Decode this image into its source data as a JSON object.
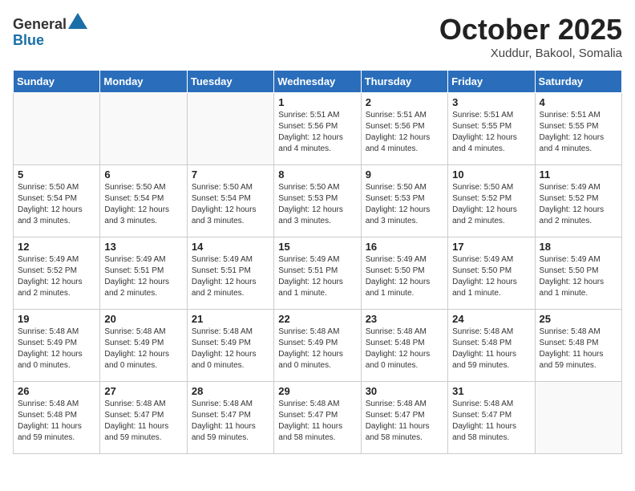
{
  "header": {
    "logo_general": "General",
    "logo_blue": "Blue",
    "month_title": "October 2025",
    "location": "Xuddur, Bakool, Somalia"
  },
  "days_of_week": [
    "Sunday",
    "Monday",
    "Tuesday",
    "Wednesday",
    "Thursday",
    "Friday",
    "Saturday"
  ],
  "weeks": [
    [
      {
        "num": "",
        "info": ""
      },
      {
        "num": "",
        "info": ""
      },
      {
        "num": "",
        "info": ""
      },
      {
        "num": "1",
        "info": "Sunrise: 5:51 AM\nSunset: 5:56 PM\nDaylight: 12 hours\nand 4 minutes."
      },
      {
        "num": "2",
        "info": "Sunrise: 5:51 AM\nSunset: 5:56 PM\nDaylight: 12 hours\nand 4 minutes."
      },
      {
        "num": "3",
        "info": "Sunrise: 5:51 AM\nSunset: 5:55 PM\nDaylight: 12 hours\nand 4 minutes."
      },
      {
        "num": "4",
        "info": "Sunrise: 5:51 AM\nSunset: 5:55 PM\nDaylight: 12 hours\nand 4 minutes."
      }
    ],
    [
      {
        "num": "5",
        "info": "Sunrise: 5:50 AM\nSunset: 5:54 PM\nDaylight: 12 hours\nand 3 minutes."
      },
      {
        "num": "6",
        "info": "Sunrise: 5:50 AM\nSunset: 5:54 PM\nDaylight: 12 hours\nand 3 minutes."
      },
      {
        "num": "7",
        "info": "Sunrise: 5:50 AM\nSunset: 5:54 PM\nDaylight: 12 hours\nand 3 minutes."
      },
      {
        "num": "8",
        "info": "Sunrise: 5:50 AM\nSunset: 5:53 PM\nDaylight: 12 hours\nand 3 minutes."
      },
      {
        "num": "9",
        "info": "Sunrise: 5:50 AM\nSunset: 5:53 PM\nDaylight: 12 hours\nand 3 minutes."
      },
      {
        "num": "10",
        "info": "Sunrise: 5:50 AM\nSunset: 5:52 PM\nDaylight: 12 hours\nand 2 minutes."
      },
      {
        "num": "11",
        "info": "Sunrise: 5:49 AM\nSunset: 5:52 PM\nDaylight: 12 hours\nand 2 minutes."
      }
    ],
    [
      {
        "num": "12",
        "info": "Sunrise: 5:49 AM\nSunset: 5:52 PM\nDaylight: 12 hours\nand 2 minutes."
      },
      {
        "num": "13",
        "info": "Sunrise: 5:49 AM\nSunset: 5:51 PM\nDaylight: 12 hours\nand 2 minutes."
      },
      {
        "num": "14",
        "info": "Sunrise: 5:49 AM\nSunset: 5:51 PM\nDaylight: 12 hours\nand 2 minutes."
      },
      {
        "num": "15",
        "info": "Sunrise: 5:49 AM\nSunset: 5:51 PM\nDaylight: 12 hours\nand 1 minute."
      },
      {
        "num": "16",
        "info": "Sunrise: 5:49 AM\nSunset: 5:50 PM\nDaylight: 12 hours\nand 1 minute."
      },
      {
        "num": "17",
        "info": "Sunrise: 5:49 AM\nSunset: 5:50 PM\nDaylight: 12 hours\nand 1 minute."
      },
      {
        "num": "18",
        "info": "Sunrise: 5:49 AM\nSunset: 5:50 PM\nDaylight: 12 hours\nand 1 minute."
      }
    ],
    [
      {
        "num": "19",
        "info": "Sunrise: 5:48 AM\nSunset: 5:49 PM\nDaylight: 12 hours\nand 0 minutes."
      },
      {
        "num": "20",
        "info": "Sunrise: 5:48 AM\nSunset: 5:49 PM\nDaylight: 12 hours\nand 0 minutes."
      },
      {
        "num": "21",
        "info": "Sunrise: 5:48 AM\nSunset: 5:49 PM\nDaylight: 12 hours\nand 0 minutes."
      },
      {
        "num": "22",
        "info": "Sunrise: 5:48 AM\nSunset: 5:49 PM\nDaylight: 12 hours\nand 0 minutes."
      },
      {
        "num": "23",
        "info": "Sunrise: 5:48 AM\nSunset: 5:48 PM\nDaylight: 12 hours\nand 0 minutes."
      },
      {
        "num": "24",
        "info": "Sunrise: 5:48 AM\nSunset: 5:48 PM\nDaylight: 11 hours\nand 59 minutes."
      },
      {
        "num": "25",
        "info": "Sunrise: 5:48 AM\nSunset: 5:48 PM\nDaylight: 11 hours\nand 59 minutes."
      }
    ],
    [
      {
        "num": "26",
        "info": "Sunrise: 5:48 AM\nSunset: 5:48 PM\nDaylight: 11 hours\nand 59 minutes."
      },
      {
        "num": "27",
        "info": "Sunrise: 5:48 AM\nSunset: 5:47 PM\nDaylight: 11 hours\nand 59 minutes."
      },
      {
        "num": "28",
        "info": "Sunrise: 5:48 AM\nSunset: 5:47 PM\nDaylight: 11 hours\nand 59 minutes."
      },
      {
        "num": "29",
        "info": "Sunrise: 5:48 AM\nSunset: 5:47 PM\nDaylight: 11 hours\nand 58 minutes."
      },
      {
        "num": "30",
        "info": "Sunrise: 5:48 AM\nSunset: 5:47 PM\nDaylight: 11 hours\nand 58 minutes."
      },
      {
        "num": "31",
        "info": "Sunrise: 5:48 AM\nSunset: 5:47 PM\nDaylight: 11 hours\nand 58 minutes."
      },
      {
        "num": "",
        "info": ""
      }
    ]
  ]
}
